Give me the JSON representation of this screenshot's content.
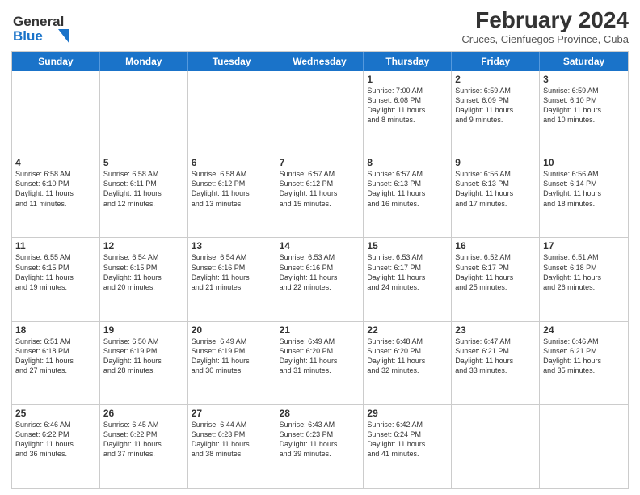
{
  "header": {
    "logo_line1": "General",
    "logo_line2": "Blue",
    "month_title": "February 2024",
    "subtitle": "Cruces, Cienfuegos Province, Cuba"
  },
  "days_of_week": [
    "Sunday",
    "Monday",
    "Tuesday",
    "Wednesday",
    "Thursday",
    "Friday",
    "Saturday"
  ],
  "weeks": [
    [
      {
        "day": "",
        "info": ""
      },
      {
        "day": "",
        "info": ""
      },
      {
        "day": "",
        "info": ""
      },
      {
        "day": "",
        "info": ""
      },
      {
        "day": "1",
        "info": "Sunrise: 7:00 AM\nSunset: 6:08 PM\nDaylight: 11 hours\nand 8 minutes."
      },
      {
        "day": "2",
        "info": "Sunrise: 6:59 AM\nSunset: 6:09 PM\nDaylight: 11 hours\nand 9 minutes."
      },
      {
        "day": "3",
        "info": "Sunrise: 6:59 AM\nSunset: 6:10 PM\nDaylight: 11 hours\nand 10 minutes."
      }
    ],
    [
      {
        "day": "4",
        "info": "Sunrise: 6:58 AM\nSunset: 6:10 PM\nDaylight: 11 hours\nand 11 minutes."
      },
      {
        "day": "5",
        "info": "Sunrise: 6:58 AM\nSunset: 6:11 PM\nDaylight: 11 hours\nand 12 minutes."
      },
      {
        "day": "6",
        "info": "Sunrise: 6:58 AM\nSunset: 6:12 PM\nDaylight: 11 hours\nand 13 minutes."
      },
      {
        "day": "7",
        "info": "Sunrise: 6:57 AM\nSunset: 6:12 PM\nDaylight: 11 hours\nand 15 minutes."
      },
      {
        "day": "8",
        "info": "Sunrise: 6:57 AM\nSunset: 6:13 PM\nDaylight: 11 hours\nand 16 minutes."
      },
      {
        "day": "9",
        "info": "Sunrise: 6:56 AM\nSunset: 6:13 PM\nDaylight: 11 hours\nand 17 minutes."
      },
      {
        "day": "10",
        "info": "Sunrise: 6:56 AM\nSunset: 6:14 PM\nDaylight: 11 hours\nand 18 minutes."
      }
    ],
    [
      {
        "day": "11",
        "info": "Sunrise: 6:55 AM\nSunset: 6:15 PM\nDaylight: 11 hours\nand 19 minutes."
      },
      {
        "day": "12",
        "info": "Sunrise: 6:54 AM\nSunset: 6:15 PM\nDaylight: 11 hours\nand 20 minutes."
      },
      {
        "day": "13",
        "info": "Sunrise: 6:54 AM\nSunset: 6:16 PM\nDaylight: 11 hours\nand 21 minutes."
      },
      {
        "day": "14",
        "info": "Sunrise: 6:53 AM\nSunset: 6:16 PM\nDaylight: 11 hours\nand 22 minutes."
      },
      {
        "day": "15",
        "info": "Sunrise: 6:53 AM\nSunset: 6:17 PM\nDaylight: 11 hours\nand 24 minutes."
      },
      {
        "day": "16",
        "info": "Sunrise: 6:52 AM\nSunset: 6:17 PM\nDaylight: 11 hours\nand 25 minutes."
      },
      {
        "day": "17",
        "info": "Sunrise: 6:51 AM\nSunset: 6:18 PM\nDaylight: 11 hours\nand 26 minutes."
      }
    ],
    [
      {
        "day": "18",
        "info": "Sunrise: 6:51 AM\nSunset: 6:18 PM\nDaylight: 11 hours\nand 27 minutes."
      },
      {
        "day": "19",
        "info": "Sunrise: 6:50 AM\nSunset: 6:19 PM\nDaylight: 11 hours\nand 28 minutes."
      },
      {
        "day": "20",
        "info": "Sunrise: 6:49 AM\nSunset: 6:19 PM\nDaylight: 11 hours\nand 30 minutes."
      },
      {
        "day": "21",
        "info": "Sunrise: 6:49 AM\nSunset: 6:20 PM\nDaylight: 11 hours\nand 31 minutes."
      },
      {
        "day": "22",
        "info": "Sunrise: 6:48 AM\nSunset: 6:20 PM\nDaylight: 11 hours\nand 32 minutes."
      },
      {
        "day": "23",
        "info": "Sunrise: 6:47 AM\nSunset: 6:21 PM\nDaylight: 11 hours\nand 33 minutes."
      },
      {
        "day": "24",
        "info": "Sunrise: 6:46 AM\nSunset: 6:21 PM\nDaylight: 11 hours\nand 35 minutes."
      }
    ],
    [
      {
        "day": "25",
        "info": "Sunrise: 6:46 AM\nSunset: 6:22 PM\nDaylight: 11 hours\nand 36 minutes."
      },
      {
        "day": "26",
        "info": "Sunrise: 6:45 AM\nSunset: 6:22 PM\nDaylight: 11 hours\nand 37 minutes."
      },
      {
        "day": "27",
        "info": "Sunrise: 6:44 AM\nSunset: 6:23 PM\nDaylight: 11 hours\nand 38 minutes."
      },
      {
        "day": "28",
        "info": "Sunrise: 6:43 AM\nSunset: 6:23 PM\nDaylight: 11 hours\nand 39 minutes."
      },
      {
        "day": "29",
        "info": "Sunrise: 6:42 AM\nSunset: 6:24 PM\nDaylight: 11 hours\nand 41 minutes."
      },
      {
        "day": "",
        "info": ""
      },
      {
        "day": "",
        "info": ""
      }
    ]
  ]
}
